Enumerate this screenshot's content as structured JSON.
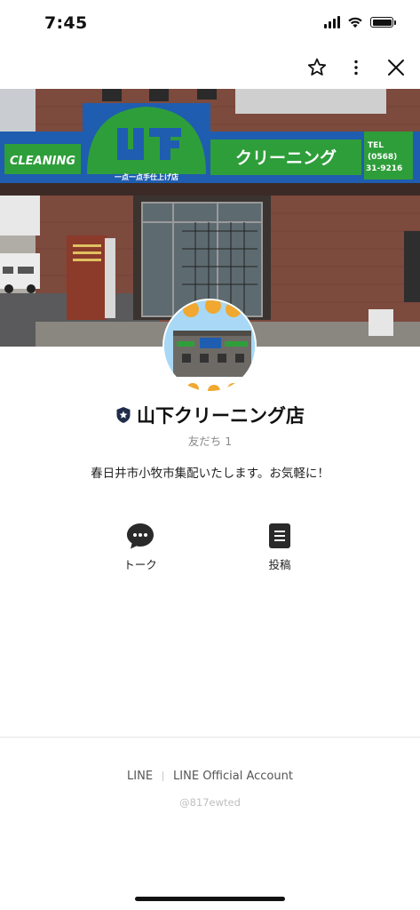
{
  "status_bar": {
    "time": "7:45"
  },
  "top_bar": {
    "icons": [
      "star-outline-icon",
      "more-vertical-icon",
      "close-icon"
    ]
  },
  "cover": {
    "sign_left": "CLEANING",
    "sign_center": "一点一点手仕上げ店",
    "sign_right": "クリーニング",
    "sign_tel_label": "TEL",
    "sign_tel_line1": "(0568)",
    "sign_tel_line2": "31-9216",
    "colors": {
      "sign_green": "#2e9e3a",
      "sign_blue": "#1f5db0",
      "brick": "#7d4a3e"
    }
  },
  "profile": {
    "name": "山下クリーニング店",
    "friends": "友だち 1",
    "description": "春日井市小牧市集配いたします。お気軽に！",
    "badge_icon": "shield-star-icon"
  },
  "actions": [
    {
      "label": "トーク",
      "icon": "chat-bubble-icon"
    },
    {
      "label": "投稿",
      "icon": "post-document-icon"
    }
  ],
  "footer": {
    "link_line": "LINE",
    "link_official": "LINE Official Account",
    "account_id": "@817ewted"
  }
}
